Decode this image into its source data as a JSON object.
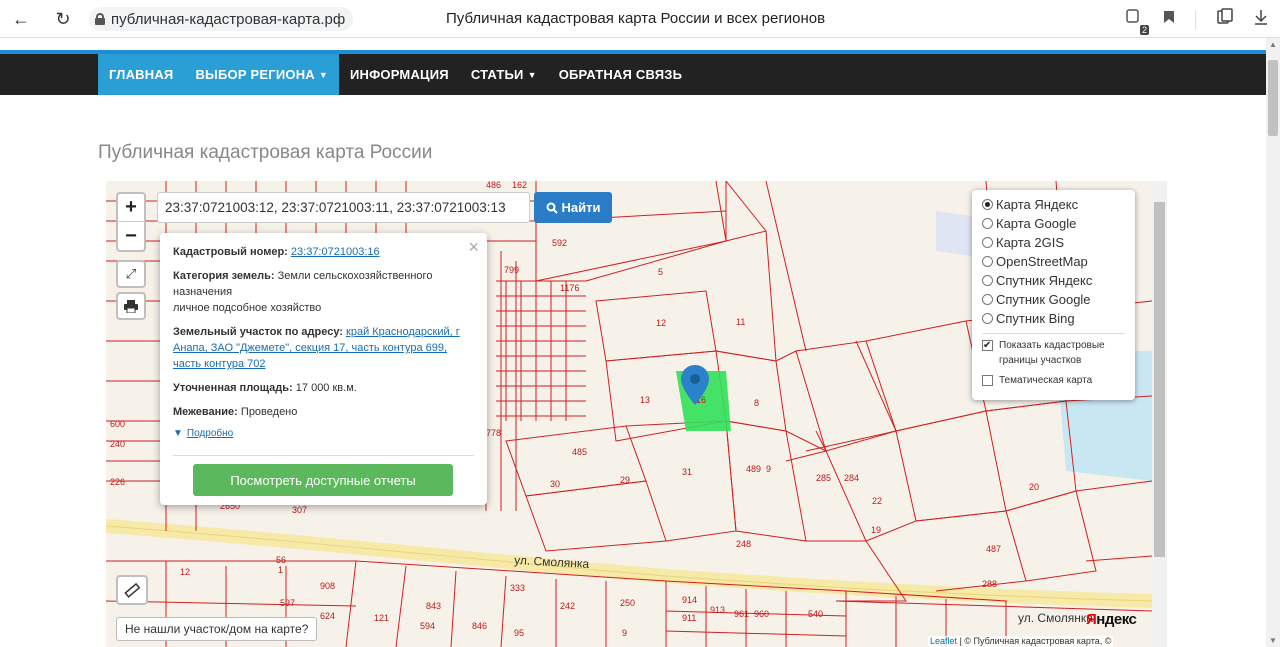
{
  "browser": {
    "back": "←",
    "reload": "↻",
    "url": "публичная-кадастровая-карта.рф",
    "title": "Публичная кадастровая карта России и всех регионов",
    "badge_count": "2"
  },
  "nav": {
    "items": [
      {
        "label": "ГЛАВНАЯ",
        "active": true
      },
      {
        "label": "ВЫБОР РЕГИОНА",
        "active": true,
        "caret": true
      },
      {
        "label": "ИНФОРМАЦИЯ"
      },
      {
        "label": "СТАТЬИ",
        "caret": true
      },
      {
        "label": "ОБРАТНАЯ СВЯЗЬ"
      }
    ]
  },
  "page": {
    "heading": "Публичная кадастровая карта России"
  },
  "map": {
    "search_value": "23:37:0721003:12, 23:37:0721003:11, 23:37:0721003:13",
    "find_label": "Найти",
    "zoom_in": "+",
    "zoom_out": "−",
    "popup": {
      "cad_label": "Кадастровый номер:",
      "cad_value": "23:37:0721003:16",
      "category_label": "Категория земель:",
      "category_value": "Земли сельскохозяйственного назначения",
      "category_use": "личное подсобное хозяйство",
      "address_label": "Земельный участок по адресу:",
      "address_value": "край Краснодарский, г Анапа, ЗАО \"Джемете\", секция 17, часть контура 699, часть контура 702",
      "area_label": "Уточненная площадь:",
      "area_value": "17 000 кв.м.",
      "survey_label": "Межевание:",
      "survey_value": "Проведено",
      "more_label": "Подробно",
      "report_button": "Посмотреть доступные отчеты",
      "close": "×"
    },
    "layers": {
      "options": [
        {
          "label": "Карта Яндекс",
          "selected": true
        },
        {
          "label": "Карта Google"
        },
        {
          "label": "Карта 2GIS"
        },
        {
          "label": "OpenStreetMap"
        },
        {
          "label": "Спутник Яндекс"
        },
        {
          "label": "Спутник Google"
        },
        {
          "label": "Спутник Bing"
        }
      ],
      "show_borders": "Показать кадастровые границы участков",
      "thematic": "Тематическая карта"
    },
    "not_found_button": "Не нашли участок/дом на карте?",
    "attribution_leaflet": "Leaflet",
    "attribution_rest": "| © Публичная кадастровая карта, ©",
    "yandex_logo_y": "Я",
    "yandex_logo_rest": "ндекс",
    "street_smolyanka": "ул. Смолянка",
    "street_smolyanka_right": "ул. Смолянка",
    "parcel_labels": [
      "486",
      "162",
      "592",
      "799",
      "5",
      "1176",
      "12",
      "11",
      "13",
      "8",
      "16",
      "485",
      "489",
      "9",
      "285",
      "284",
      "22",
      "31",
      "30",
      "29",
      "20",
      "19",
      "248",
      "487",
      "288",
      "307",
      "2650",
      "12",
      "56",
      "1",
      "843",
      "594",
      "846",
      "95",
      "242",
      "250",
      "9",
      "914",
      "911",
      "913",
      "961",
      "960",
      "540",
      "121",
      "333",
      "597",
      "624",
      "908",
      "240",
      "226",
      "600",
      "778"
    ]
  }
}
